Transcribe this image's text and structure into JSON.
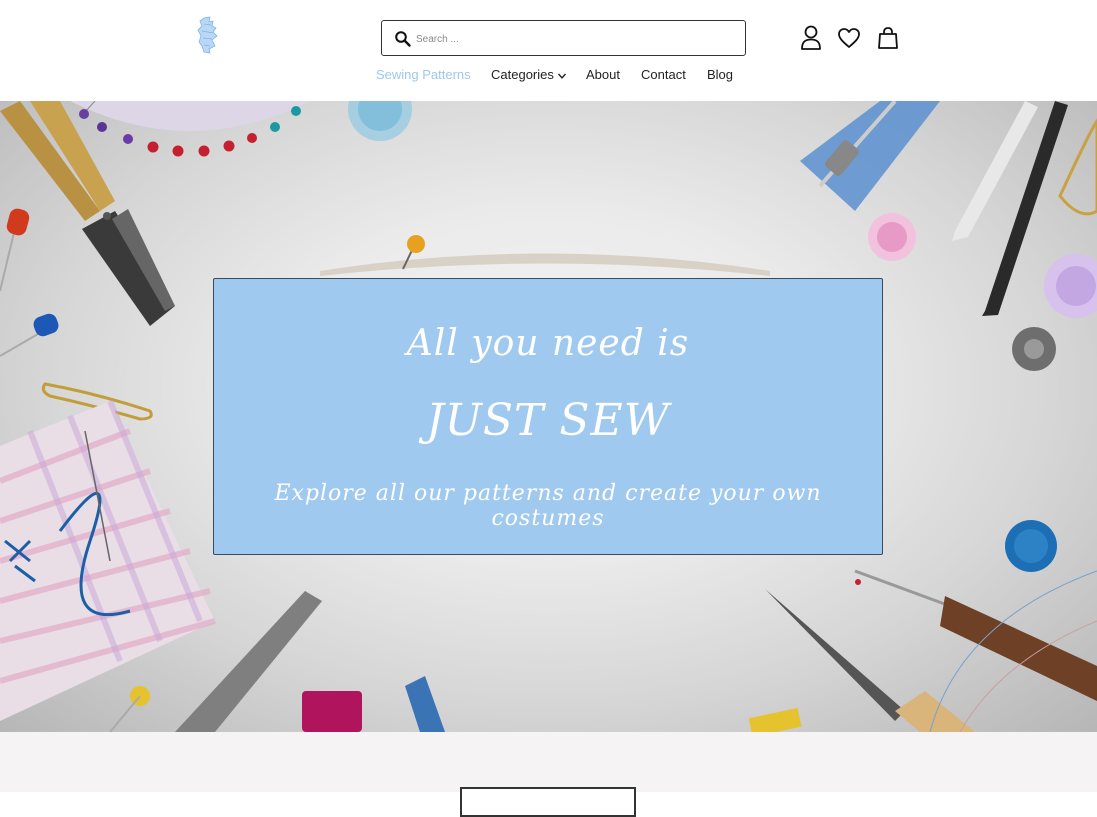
{
  "header": {
    "search": {
      "placeholder": "Search ...",
      "value": ""
    },
    "icons": [
      "account-icon",
      "heart-icon",
      "bag-icon"
    ]
  },
  "nav": {
    "items": [
      {
        "label": "Sewing Patterns",
        "active": true
      },
      {
        "label": "Categories",
        "dropdown": true
      },
      {
        "label": "About"
      },
      {
        "label": "Contact"
      },
      {
        "label": "Blog"
      }
    ]
  },
  "hero": {
    "line1": "All you need is",
    "line2": "JUST SEW",
    "line3": "Explore all our patterns and create your own costumes"
  },
  "colors": {
    "accent": "#9cc7ee",
    "banner": "#a0c9ef",
    "below": "#f5f3f4"
  }
}
